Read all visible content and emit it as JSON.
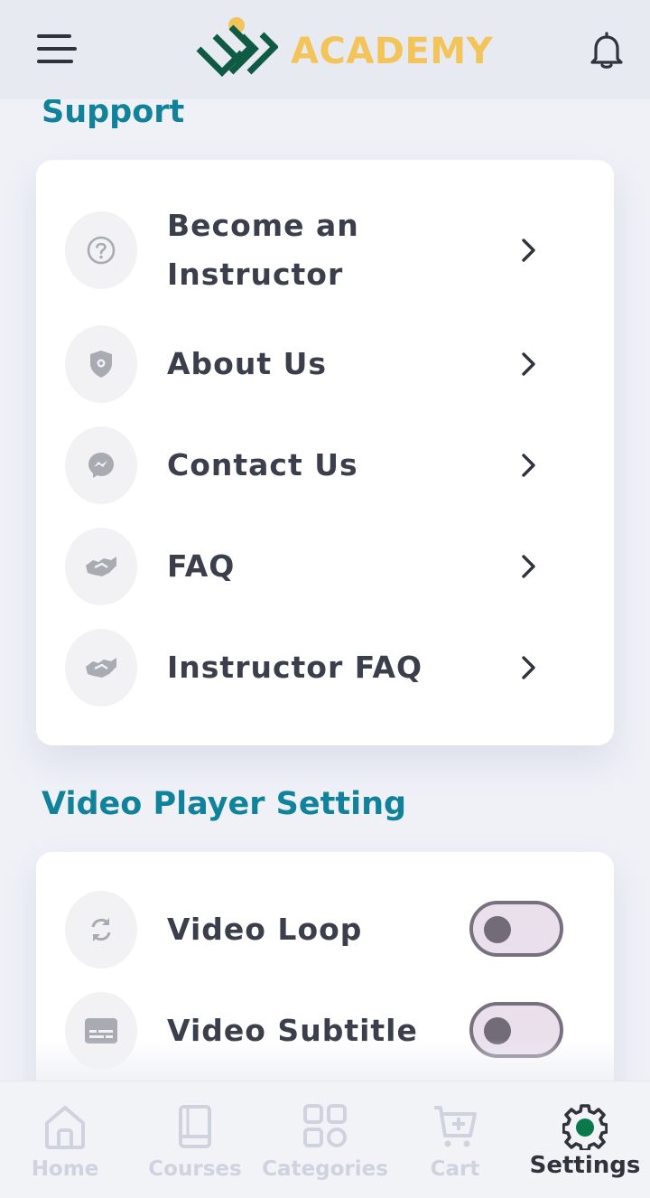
{
  "header": {
    "brand": "ACADEMY",
    "brand_color": "#f3c45a",
    "logo_icon": "academy-logo",
    "menu_icon": "hamburger-menu-icon",
    "notification_icon": "bell-icon"
  },
  "support": {
    "title": "Support",
    "items": [
      {
        "label": "Become an Instructor",
        "icon": "question-circle-icon"
      },
      {
        "label": "About Us",
        "icon": "shield-gear-icon"
      },
      {
        "label": "Contact Us",
        "icon": "messenger-icon"
      },
      {
        "label": "FAQ",
        "icon": "handshake-icon"
      },
      {
        "label": "Instructor FAQ",
        "icon": "handshake-icon"
      }
    ]
  },
  "video_settings": {
    "title": "Video Player Setting",
    "items": [
      {
        "label": "Video Loop",
        "icon": "loop-icon",
        "enabled": false
      },
      {
        "label": "Video Subtitle",
        "icon": "subtitles-icon",
        "enabled": false
      }
    ]
  },
  "bottom_nav": {
    "active": "Settings",
    "accent": "#0b7a4b",
    "items": [
      {
        "label": "Home",
        "icon": "home-icon"
      },
      {
        "label": "Courses",
        "icon": "book-icon"
      },
      {
        "label": "Categories",
        "icon": "categories-grid-icon"
      },
      {
        "label": "Cart",
        "icon": "cart-icon"
      },
      {
        "label": "Settings",
        "icon": "gear-icon"
      }
    ]
  }
}
